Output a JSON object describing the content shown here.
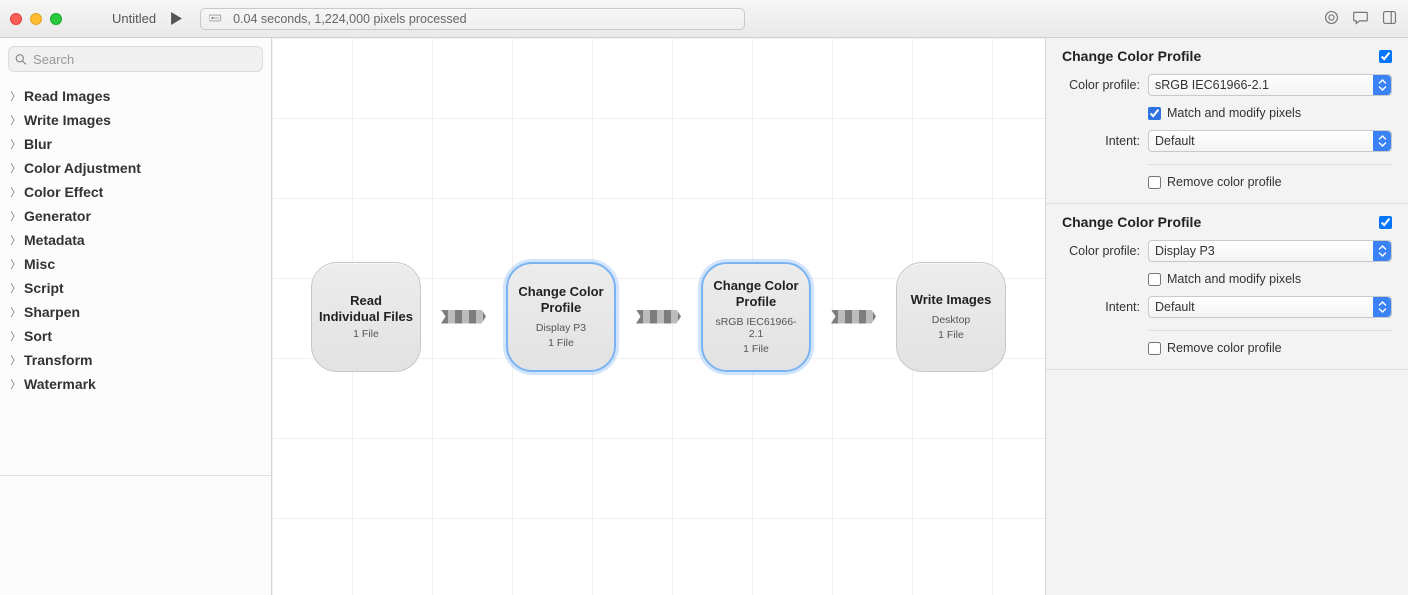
{
  "titlebar": {
    "doc_title": "Untitled",
    "status_text": "0.04 seconds, 1,224,000 pixels processed"
  },
  "sidebar": {
    "search_placeholder": "Search",
    "categories": [
      {
        "label": "Read Images"
      },
      {
        "label": "Write Images"
      },
      {
        "label": "Blur"
      },
      {
        "label": "Color Adjustment"
      },
      {
        "label": "Color Effect"
      },
      {
        "label": "Generator"
      },
      {
        "label": "Metadata"
      },
      {
        "label": "Misc"
      },
      {
        "label": "Script"
      },
      {
        "label": "Sharpen"
      },
      {
        "label": "Sort"
      },
      {
        "label": "Transform"
      },
      {
        "label": "Watermark"
      }
    ]
  },
  "canvas": {
    "nodes": [
      {
        "title": "Read Individual Files",
        "sub": "",
        "count": "1 File",
        "selected": false
      },
      {
        "title": "Change Color Profile",
        "sub": "Display P3",
        "count": "1 File",
        "selected": true
      },
      {
        "title": "Change Color Profile",
        "sub": "sRGB IEC61966-2.1",
        "count": "1 File",
        "selected": true
      },
      {
        "title": "Write Images",
        "sub": "Desktop",
        "count": "1 File",
        "selected": false
      }
    ]
  },
  "inspector": {
    "sections": [
      {
        "heading": "Change Color Profile",
        "enabled": true,
        "profile_label": "Color profile:",
        "profile_value": "sRGB IEC61966-2.1",
        "match_label": "Match and modify pixels",
        "match_checked": true,
        "intent_label": "Intent:",
        "intent_value": "Default",
        "remove_label": "Remove color profile",
        "remove_checked": false
      },
      {
        "heading": "Change Color Profile",
        "enabled": true,
        "profile_label": "Color profile:",
        "profile_value": "Display P3",
        "match_label": "Match and modify pixels",
        "match_checked": false,
        "intent_label": "Intent:",
        "intent_value": "Default",
        "remove_label": "Remove color profile",
        "remove_checked": false
      }
    ]
  }
}
